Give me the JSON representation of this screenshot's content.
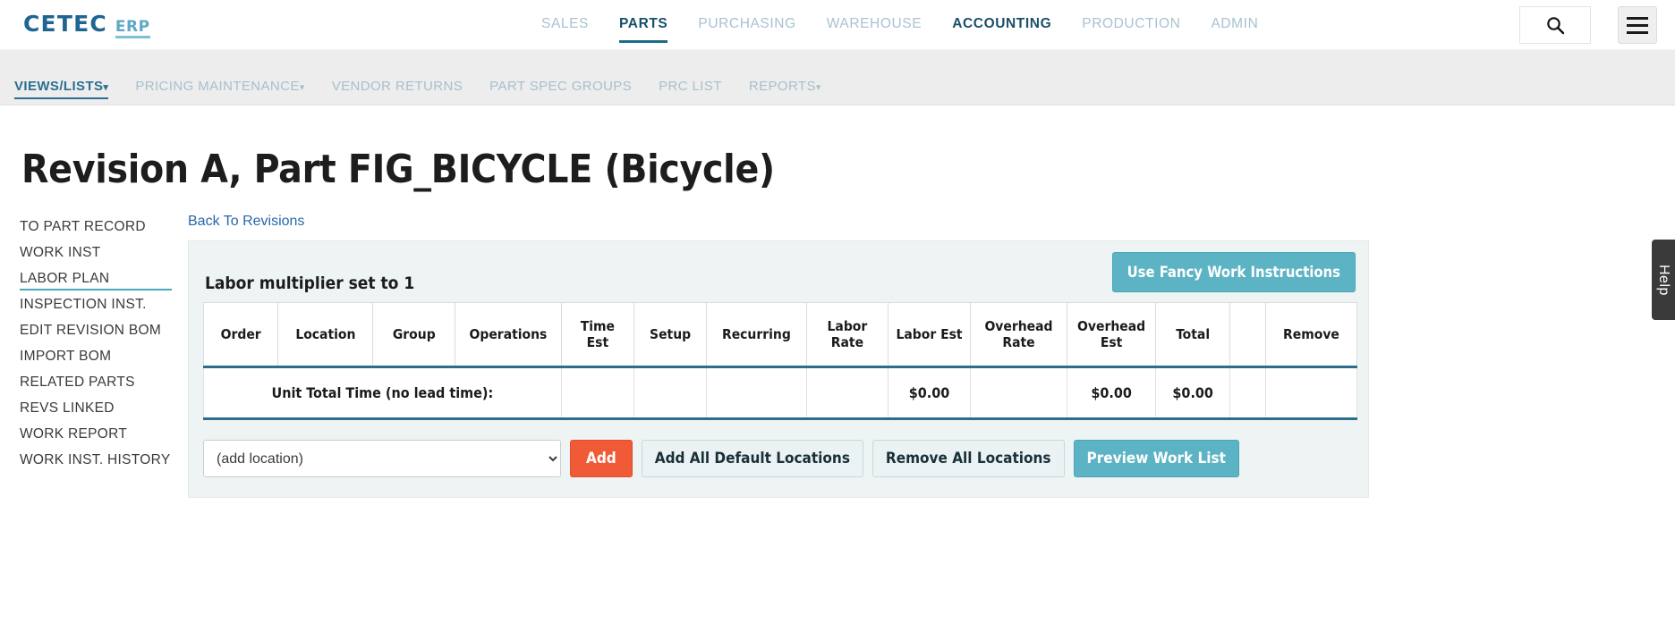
{
  "header": {
    "logo_primary": "CETEC",
    "logo_secondary": "ERP",
    "nav": [
      {
        "label": "SALES",
        "state": "muted"
      },
      {
        "label": "PARTS",
        "state": "active"
      },
      {
        "label": "PURCHASING",
        "state": "muted"
      },
      {
        "label": "WAREHOUSE",
        "state": "muted"
      },
      {
        "label": "ACCOUNTING",
        "state": "dark"
      },
      {
        "label": "PRODUCTION",
        "state": "muted"
      },
      {
        "label": "ADMIN",
        "state": "muted"
      }
    ],
    "search_placeholder": "",
    "search_value": "",
    "search_icon": "search-icon",
    "menu_icon": "hamburger-icon"
  },
  "subnav": [
    {
      "label": "VIEWS/LISTS",
      "caret": "▾",
      "state": "active"
    },
    {
      "label": "PRICING MAINTENANCE",
      "caret": "▾",
      "state": "muted"
    },
    {
      "label": "VENDOR RETURNS",
      "caret": "",
      "state": "muted"
    },
    {
      "label": "PART SPEC GROUPS",
      "caret": "",
      "state": "muted"
    },
    {
      "label": "PRC LIST",
      "caret": "",
      "state": "muted"
    },
    {
      "label": "REPORTS",
      "caret": "▾",
      "state": "muted"
    }
  ],
  "page": {
    "title": "Revision A, Part FIG_BICYCLE (Bicycle)",
    "back_link": "Back To Revisions"
  },
  "sidebar": {
    "items": [
      {
        "label": "TO PART RECORD",
        "state": "normal"
      },
      {
        "label": "WORK INST",
        "state": "normal"
      },
      {
        "label": "LABOR PLAN",
        "state": "active"
      },
      {
        "label": "INSPECTION INST.",
        "state": "normal"
      },
      {
        "label": "EDIT REVISION BOM",
        "state": "normal"
      },
      {
        "label": "IMPORT BOM",
        "state": "normal"
      },
      {
        "label": "RELATED PARTS",
        "state": "normal"
      },
      {
        "label": "REVS LINKED",
        "state": "normal"
      },
      {
        "label": "WORK REPORT",
        "state": "normal"
      },
      {
        "label": "WORK INST. HISTORY",
        "state": "normal"
      }
    ]
  },
  "panel": {
    "fancy_button": "Use Fancy Work Instructions",
    "multiplier_text": "Labor multiplier set to 1",
    "table": {
      "columns": [
        "Order",
        "Location",
        "Group",
        "Operations",
        "Time Est",
        "Setup",
        "Recurring",
        "Labor Rate",
        "Labor Est",
        "Overhead Rate",
        "Overhead Est",
        "Total",
        "",
        "Remove"
      ],
      "total_row": {
        "label": "Unit Total Time (no lead time):",
        "order": "",
        "location": "",
        "group": "",
        "time_est": "",
        "setup": "",
        "recurring": "",
        "labor_rate": "",
        "labor_est": "$0.00",
        "overhead_rate": "",
        "overhead_est": "$0.00",
        "total": "$0.00",
        "spacer": "",
        "remove": ""
      }
    },
    "location_select": {
      "value": "(add location)",
      "options": [
        "(add location)"
      ]
    },
    "buttons": {
      "add": "Add",
      "add_all_default": "Add All Default Locations",
      "remove_all": "Remove All Locations",
      "preview": "Preview Work List"
    }
  },
  "help_tab": {
    "label": "Help"
  },
  "colors": {
    "brand_blue": "#1f6591",
    "brand_teal": "#5cb3c4",
    "accent_orange": "#f05a36",
    "link_blue": "#2767a8",
    "table_border_blue": "#2e6c8e",
    "panel_bg": "#eef3f4"
  }
}
